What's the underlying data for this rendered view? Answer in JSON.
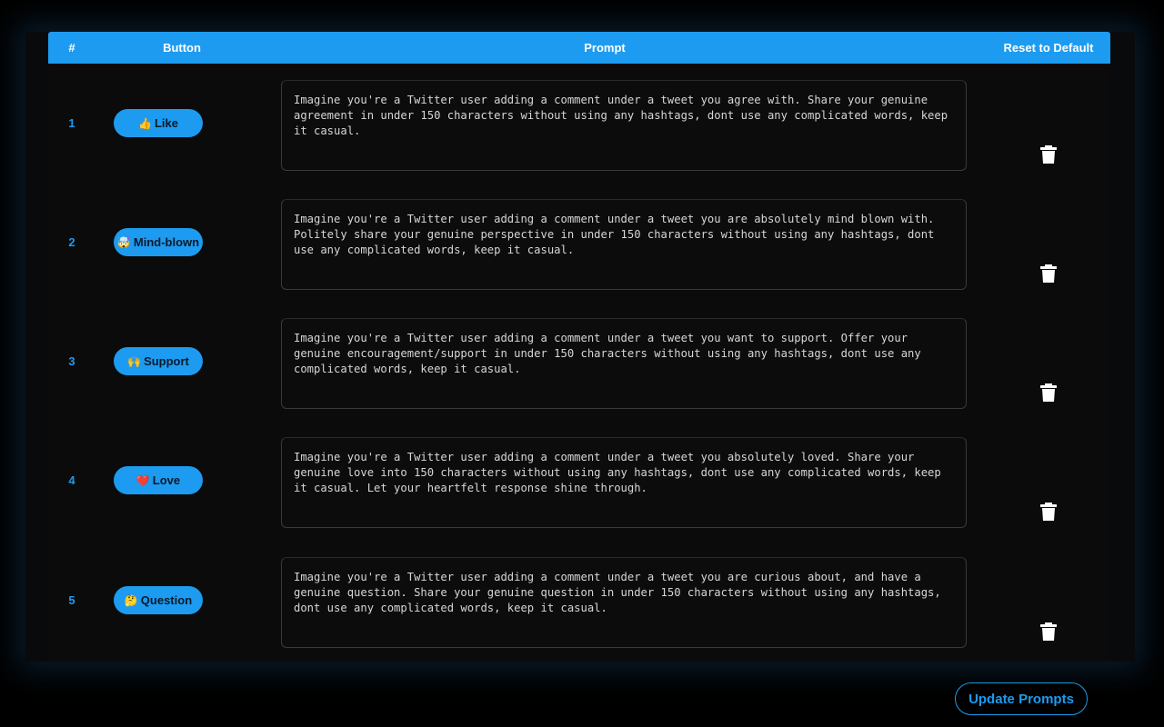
{
  "table": {
    "headers": {
      "num": "#",
      "button": "Button",
      "prompt": "Prompt",
      "reset": "Reset to Default"
    },
    "rows": [
      {
        "num": "1",
        "emoji": "👍",
        "label": "Like",
        "prompt": "Imagine you're a Twitter user adding a comment under a tweet you agree with. Share your genuine agreement in under 150 characters without using any hashtags, dont use any complicated words, keep it casual."
      },
      {
        "num": "2",
        "emoji": "🤯",
        "label": "Mind-blown",
        "prompt": "Imagine you're a Twitter user adding a comment under a tweet you are absolutely mind blown with. Politely share your genuine perspective in under 150 characters without using any hashtags, dont use any complicated words, keep it casual."
      },
      {
        "num": "3",
        "emoji": "🙌",
        "label": "Support",
        "prompt": "Imagine you're a Twitter user adding a comment under a tweet you want to support. Offer your genuine encouragement/support in under 150 characters without using any hashtags, dont use any complicated words, keep it casual."
      },
      {
        "num": "4",
        "emoji": "❤️",
        "label": "Love",
        "prompt": "Imagine you're a Twitter user adding a comment under a tweet you absolutely loved. Share your genuine love into 150 characters without using any hashtags, dont use any complicated words, keep it casual. Let your heartfelt response shine through."
      },
      {
        "num": "5",
        "emoji": "🤔",
        "label": "Question",
        "prompt": "Imagine you're a Twitter user adding a comment under a tweet you are curious about, and have a genuine question. Share your genuine question in under 150 characters without using any hashtags, dont use any complicated words, keep it casual."
      }
    ]
  },
  "footer": {
    "update_label": "Update Prompts"
  },
  "icons": {
    "reset": "trash-icon"
  },
  "colors": {
    "accent": "#1d9bf0",
    "background": "#000000",
    "panel": "#0b0b0b"
  }
}
